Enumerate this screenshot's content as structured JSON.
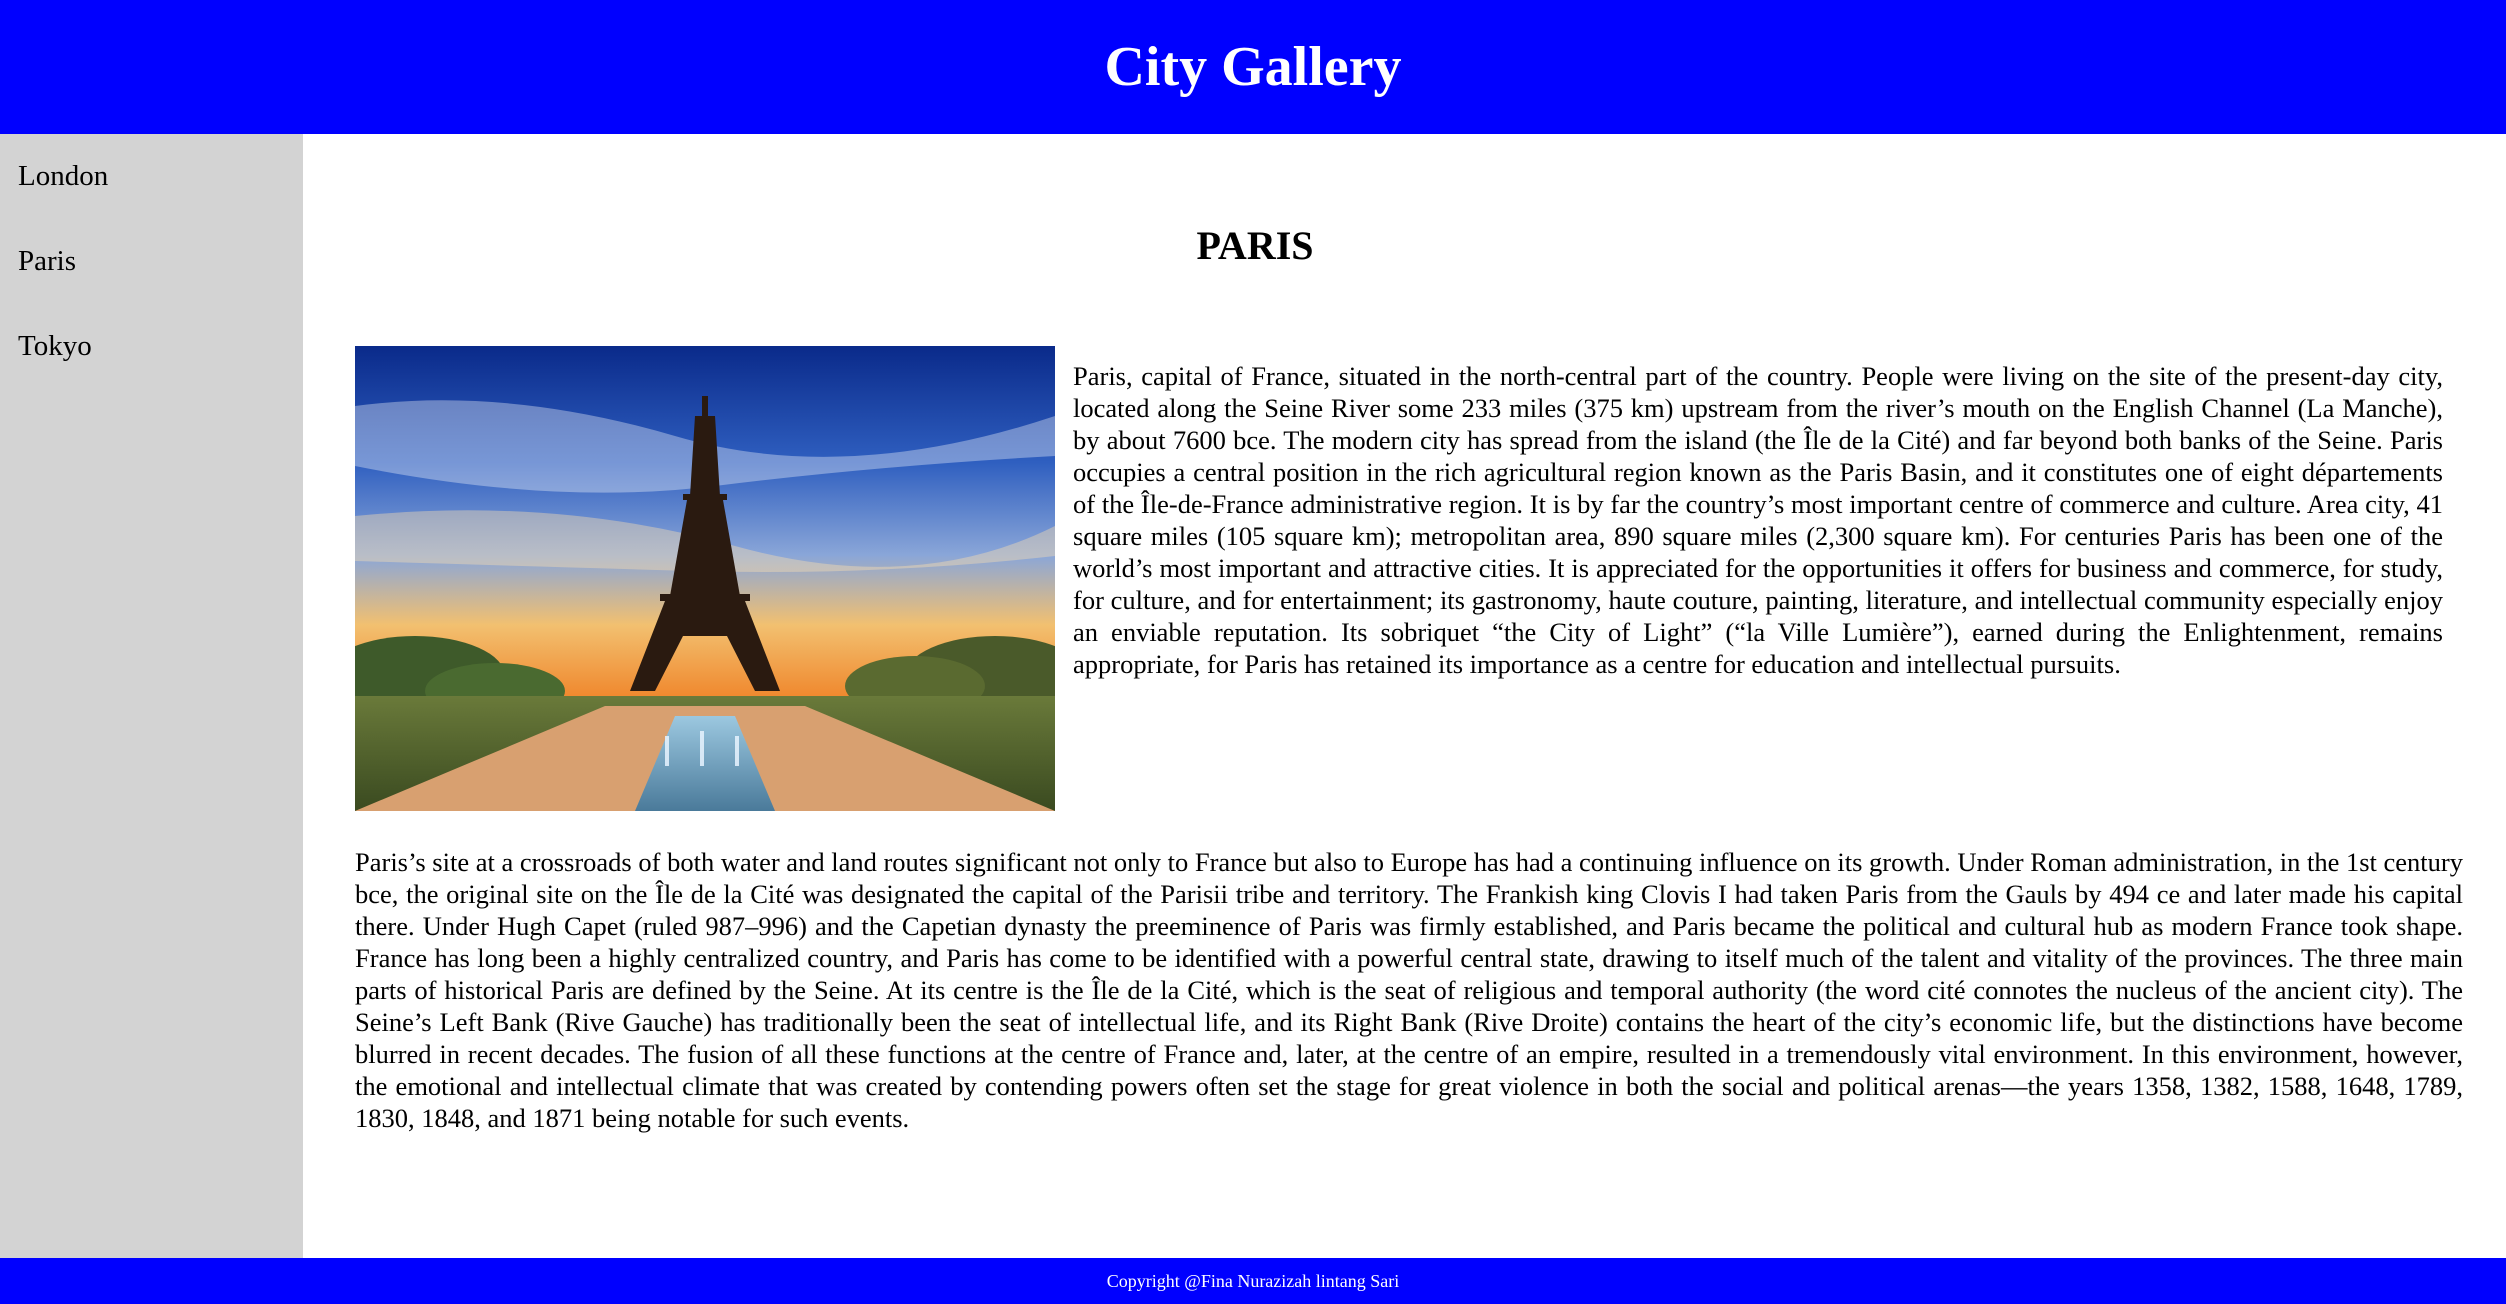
{
  "header": {
    "title": "City Gallery"
  },
  "sidebar": {
    "items": [
      {
        "label": "London"
      },
      {
        "label": "Paris"
      },
      {
        "label": "Tokyo"
      }
    ]
  },
  "main": {
    "heading": "PARIS",
    "image_alt": "Eiffel Tower at sunset",
    "paragraph1": "Paris, capital of France, situated in the north-central part of the country. People were living on the site of the present-day city, located along the Seine River some 233 miles (375 km) upstream from the river’s mouth on the English Channel (La Manche), by about 7600 bce. The modern city has spread from the island (the Île de la Cité) and far beyond both banks of the Seine. Paris occupies a central position in the rich agricultural region known as the Paris Basin, and it constitutes one of eight départements of the Île-de-France administrative region. It is by far the country’s most important centre of commerce and culture. Area city, 41 square miles (105 square km); metropolitan area, 890 square miles (2,300 square km). For centuries Paris has been one of the world’s most important and attractive cities. It is appreciated for the opportunities it offers for business and commerce, for study, for culture, and for entertainment; its gastronomy, haute couture, painting, literature, and intellectual community especially enjoy an enviable reputation. Its sobriquet “the City of Light” (“la Ville Lumière”), earned during the Enlightenment, remains appropriate, for Paris has retained its importance as a centre for education and intellectual pursuits.",
    "paragraph2": "Paris’s site at a crossroads of both water and land routes significant not only to France but also to Europe has had a continuing influence on its growth. Under Roman administration, in the 1st century bce, the original site on the Île de la Cité was designated the capital of the Parisii tribe and territory. The Frankish king Clovis I had taken Paris from the Gauls by 494 ce and later made his capital there. Under Hugh Capet (ruled 987–996) and the Capetian dynasty the preeminence of Paris was firmly established, and Paris became the political and cultural hub as modern France took shape. France has long been a highly centralized country, and Paris has come to be identified with a powerful central state, drawing to itself much of the talent and vitality of the provinces. The three main parts of historical Paris are defined by the Seine. At its centre is the Île de la Cité, which is the seat of religious and temporal authority (the word cité connotes the nucleus of the ancient city). The Seine’s Left Bank (Rive Gauche) has traditionally been the seat of intellectual life, and its Right Bank (Rive Droite) contains the heart of the city’s economic life, but the distinctions have become blurred in recent decades. The fusion of all these functions at the centre of France and, later, at the centre of an empire, resulted in a tremendously vital environment. In this environment, however, the emotional and intellectual climate that was created by contending powers often set the stage for great violence in both the social and political arenas—the years 1358, 1382, 1588, 1648, 1789, 1830, 1848, and 1871 being notable for such events."
  },
  "footer": {
    "copyright": "Copyright @Fina Nurazizah lintang Sari"
  },
  "colors": {
    "header_bg": "#0000ff",
    "footer_bg": "#0000ff",
    "sidebar_bg": "#d3d3d3",
    "header_text": "#ffffff"
  }
}
